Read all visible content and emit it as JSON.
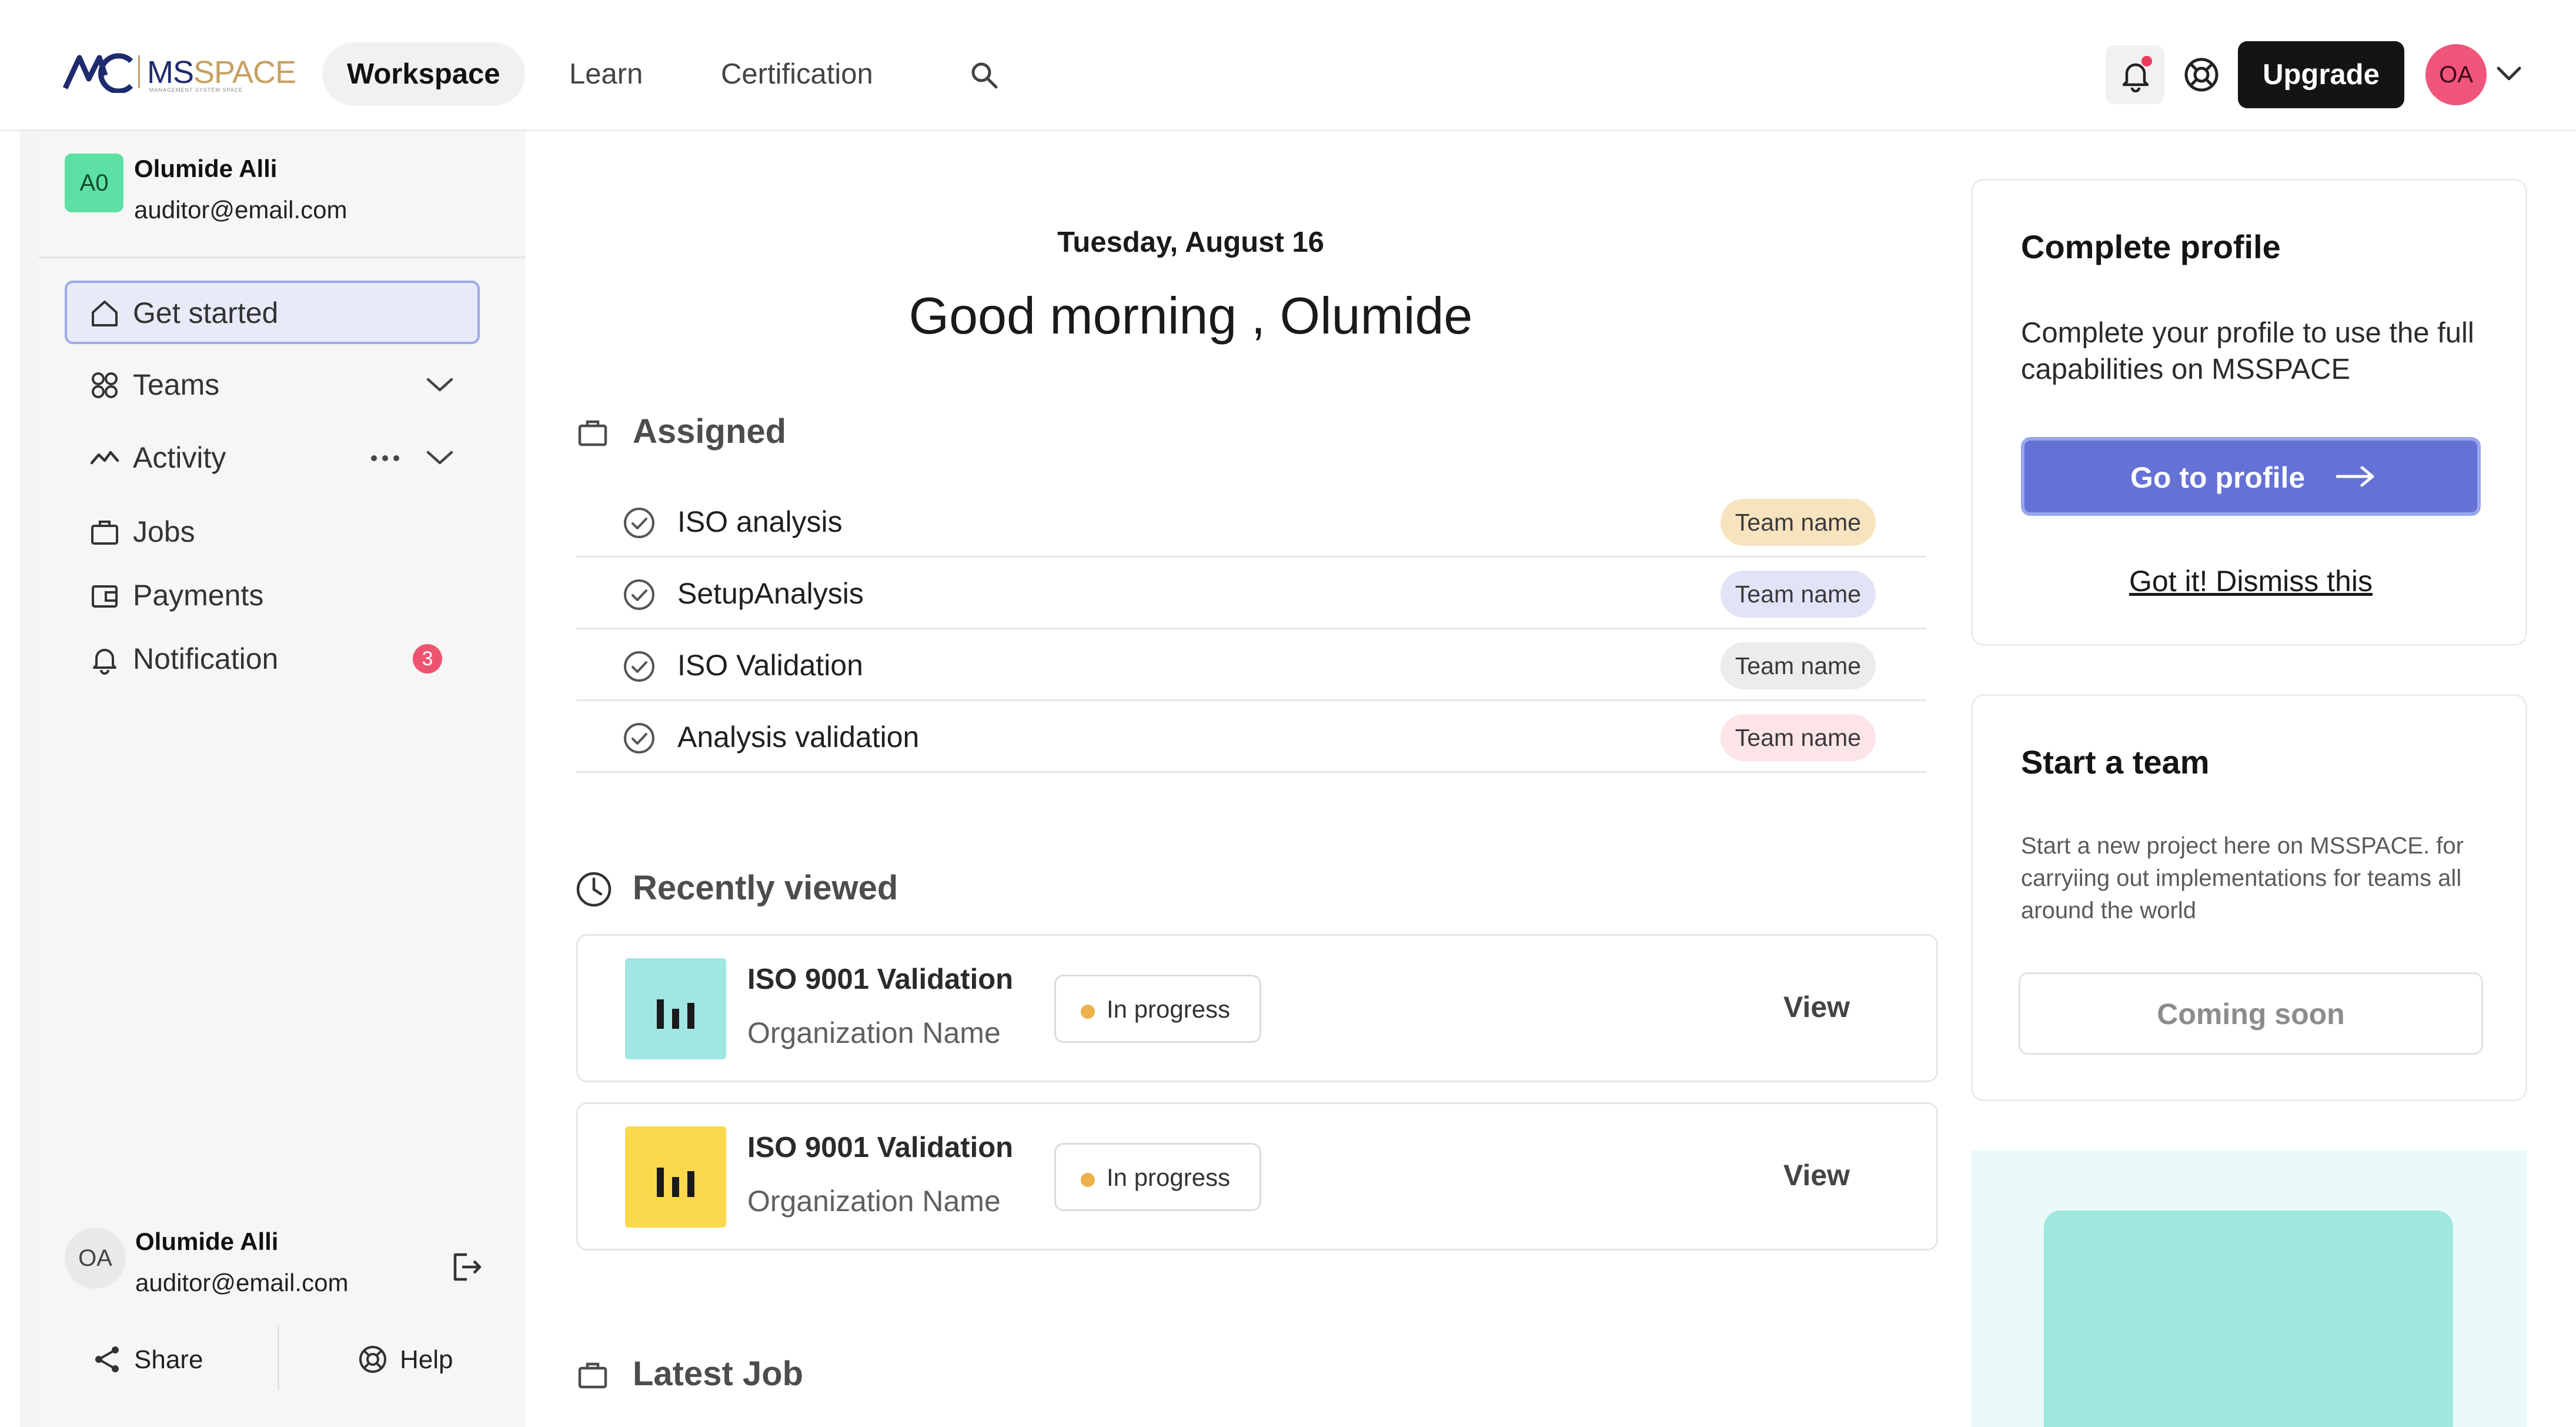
{
  "header": {
    "logo": {
      "brand_part1": "MS",
      "brand_part2": "SPACE",
      "tagline": "MANAGEMENT SYSTEM SPACE",
      "mark_icon": "msspace-logo-mark"
    },
    "tabs": [
      {
        "label": "Workspace",
        "active": true
      },
      {
        "label": "Learn",
        "active": false
      },
      {
        "label": "Certification",
        "active": false
      }
    ],
    "search_icon": "search-icon",
    "upgrade_label": "Upgrade",
    "avatar_initials": "OA",
    "notification_dot_color": "#ee3a5a"
  },
  "sidebar": {
    "user_top": {
      "initials": "A0",
      "name": "Olumide Alli",
      "email": "auditor@email.com"
    },
    "items": [
      {
        "label": "Get started",
        "icon": "home-icon",
        "active": true
      },
      {
        "label": "Teams",
        "icon": "teams-icon",
        "expandable": true
      },
      {
        "label": "Activity",
        "icon": "activity-icon",
        "expandable": true,
        "has_more_menu": true
      },
      {
        "label": "Jobs",
        "icon": "briefcase-icon"
      },
      {
        "label": "Payments",
        "icon": "wallet-icon"
      },
      {
        "label": "Notification",
        "icon": "bell-icon",
        "badge": "3"
      }
    ],
    "user_bottom": {
      "initials": "OA",
      "name": "Olumide Alli",
      "email": "auditor@email.com"
    },
    "footer": {
      "share_label": "Share",
      "help_label": "Help"
    }
  },
  "main": {
    "date": "Tuesday, August 16",
    "greeting": "Good morning , Olumide",
    "assigned": {
      "title": "Assigned",
      "rows": [
        {
          "title": "ISO analysis",
          "team": "Team name",
          "pill_color": "#f8e3bf"
        },
        {
          "title": "SetupAnalysis",
          "team": "Team name",
          "pill_color": "#e2e3f7"
        },
        {
          "title": "ISO Validation",
          "team": "Team name",
          "pill_color": "#ececec"
        },
        {
          "title": "Analysis validation",
          "team": "Team name",
          "pill_color": "#fce4e8"
        }
      ]
    },
    "recently_viewed": {
      "title": "Recently viewed",
      "items": [
        {
          "title": "ISO 9001 Validation",
          "org": "Organization Name",
          "status": "In progress",
          "action": "View",
          "thumb_color": "#9fe6e4"
        },
        {
          "title": "ISO 9001 Validation",
          "org": "Organization Name",
          "status": "In progress",
          "action": "View",
          "thumb_color": "#fbd94c"
        }
      ]
    },
    "latest_job": {
      "title": "Latest Job"
    }
  },
  "right": {
    "complete_profile": {
      "title": "Complete profile",
      "text": "Complete your profile to use the full capabilities on MSSPACE",
      "button": "Go to profile",
      "dismiss": "Got it! Dismiss this"
    },
    "start_team": {
      "title": "Start a team",
      "text": "Start a new project here on MSSPACE. for carryiing out implementations for teams all around the world",
      "button": "Coming soon"
    }
  }
}
